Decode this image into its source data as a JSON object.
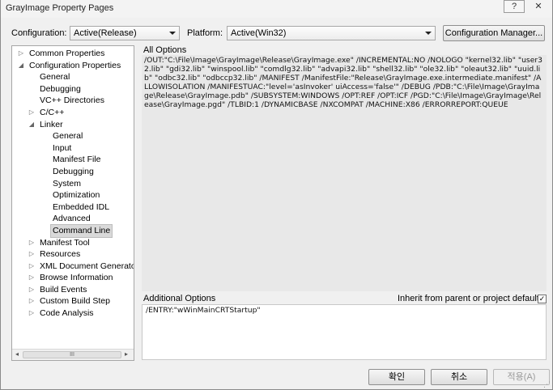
{
  "window": {
    "title": "GrayImage Property Pages",
    "help_label": "?",
    "close_label": "✕"
  },
  "config": {
    "configuration_label": "Configuration:",
    "configuration_value": "Active(Release)",
    "platform_label": "Platform:",
    "platform_value": "Active(Win32)",
    "manager_label": "Configuration Manager..."
  },
  "tree": {
    "nodes": [
      {
        "label": "Common Properties",
        "expander": "▷",
        "level": 0
      },
      {
        "label": "Configuration Properties",
        "expander": "◢",
        "level": 0
      },
      {
        "label": "General",
        "expander": "",
        "level": 1
      },
      {
        "label": "Debugging",
        "expander": "",
        "level": 1
      },
      {
        "label": "VC++ Directories",
        "expander": "",
        "level": 1
      },
      {
        "label": "C/C++",
        "expander": "▷",
        "level": 1
      },
      {
        "label": "Linker",
        "expander": "◢",
        "level": 1
      },
      {
        "label": "General",
        "expander": "",
        "level": 2
      },
      {
        "label": "Input",
        "expander": "",
        "level": 2
      },
      {
        "label": "Manifest File",
        "expander": "",
        "level": 2
      },
      {
        "label": "Debugging",
        "expander": "",
        "level": 2
      },
      {
        "label": "System",
        "expander": "",
        "level": 2
      },
      {
        "label": "Optimization",
        "expander": "",
        "level": 2
      },
      {
        "label": "Embedded IDL",
        "expander": "",
        "level": 2
      },
      {
        "label": "Advanced",
        "expander": "",
        "level": 2
      },
      {
        "label": "Command Line",
        "expander": "",
        "level": 2,
        "selected": true
      },
      {
        "label": "Manifest Tool",
        "expander": "▷",
        "level": 1
      },
      {
        "label": "Resources",
        "expander": "▷",
        "level": 1
      },
      {
        "label": "XML Document Generator",
        "expander": "▷",
        "level": 1
      },
      {
        "label": "Browse Information",
        "expander": "▷",
        "level": 1
      },
      {
        "label": "Build Events",
        "expander": "▷",
        "level": 1
      },
      {
        "label": "Custom Build Step",
        "expander": "▷",
        "level": 1
      },
      {
        "label": "Code Analysis",
        "expander": "▷",
        "level": 1
      }
    ],
    "scroll_left": "◂",
    "scroll_right": "▸",
    "scroll_grip": "III"
  },
  "all_options": {
    "label": "All Options",
    "text": "/OUT:\"C:\\File\\Image\\GrayImage\\Release\\GrayImage.exe\" /INCREMENTAL:NO /NOLOGO \"kernel32.lib\" \"user32.lib\" \"gdi32.lib\" \"winspool.lib\" \"comdlg32.lib\" \"advapi32.lib\" \"shell32.lib\" \"ole32.lib\" \"oleaut32.lib\" \"uuid.lib\" \"odbc32.lib\" \"odbccp32.lib\" /MANIFEST /ManifestFile:\"Release\\GrayImage.exe.intermediate.manifest\" /ALLOWISOLATION /MANIFESTUAC:\"level='asInvoker' uiAccess='false'\" /DEBUG /PDB:\"C:\\File\\Image\\GrayImage\\Release\\GrayImage.pdb\" /SUBSYSTEM:WINDOWS /OPT:REF /OPT:ICF /PGD:\"C:\\File\\Image\\GrayImage\\Release\\GrayImage.pgd\" /TLBID:1 /DYNAMICBASE /NXCOMPAT /MACHINE:X86 /ERRORREPORT:QUEUE"
  },
  "additional_options": {
    "label": "Additional Options",
    "inherit_label": "Inherit from parent or project defaults",
    "inherit_checked": "✓",
    "text": "/ENTRY:\"wWinMainCRTStartup\""
  },
  "footer": {
    "ok_label": "확인",
    "cancel_label": "취소",
    "apply_label": "적용(A)"
  }
}
